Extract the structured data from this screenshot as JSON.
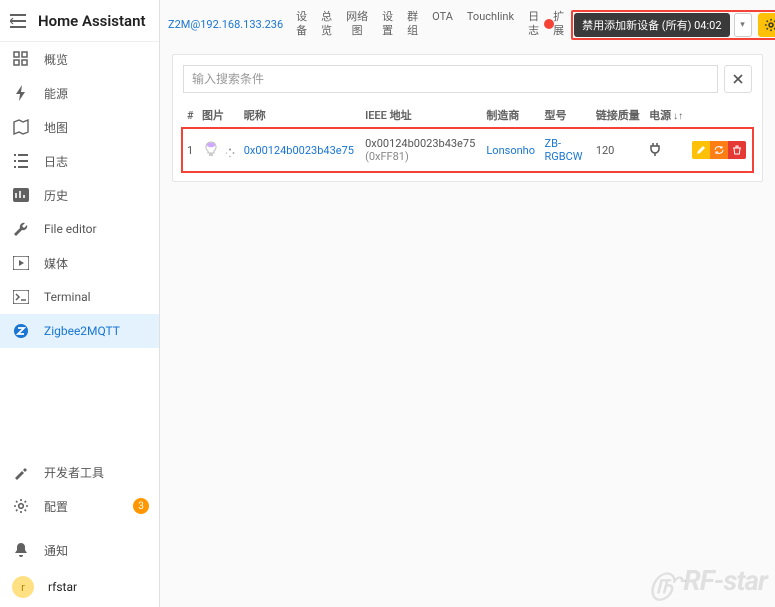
{
  "app": {
    "title": "Home Assistant"
  },
  "sidebar": {
    "items": [
      {
        "id": "overview",
        "label": "概览"
      },
      {
        "id": "energy",
        "label": "能源"
      },
      {
        "id": "map",
        "label": "地图"
      },
      {
        "id": "logbook",
        "label": "日志"
      },
      {
        "id": "history",
        "label": "历史"
      },
      {
        "id": "fileeditor",
        "label": "File editor"
      },
      {
        "id": "media",
        "label": "媒体"
      },
      {
        "id": "terminal",
        "label": "Terminal"
      },
      {
        "id": "z2m",
        "label": "Zigbee2MQTT"
      }
    ],
    "bottom": [
      {
        "id": "devtools",
        "label": "开发者工具"
      },
      {
        "id": "settings",
        "label": "配置",
        "badge": "3"
      },
      {
        "id": "notify",
        "label": "通知"
      }
    ],
    "user": {
      "initial": "r",
      "name": "rfstar"
    }
  },
  "header": {
    "host": "Z2M@192.168.133.236",
    "tabs": [
      {
        "l1": "设",
        "l2": "备"
      },
      {
        "l1": "总",
        "l2": "览"
      },
      {
        "l1": "网络",
        "l2": "图"
      },
      {
        "l1": "设",
        "l2": "置"
      },
      {
        "l1": "群",
        "l2": "组"
      },
      {
        "l1": "OTA",
        "l2": ""
      },
      {
        "l1": "Touchlink",
        "l2": ""
      },
      {
        "l1": "日",
        "l2": "志"
      },
      {
        "l1": "扩",
        "l2": "展"
      }
    ],
    "disable_label": "禁用添加新设备 (所有) 04:02"
  },
  "card": {
    "search_placeholder": "输入搜索条件",
    "columns": {
      "idx": "#",
      "pic": "图片",
      "nick": "昵称",
      "ieee": "IEEE 地址",
      "mfr": "制造商",
      "model": "型号",
      "lqi": "链接质量",
      "power": "电源"
    },
    "rows": [
      {
        "idx": "1",
        "nick": "0x00124b0023b43e75",
        "ieee_long": "0x00124b0023b43e75",
        "ieee_short": "(0xFF81)",
        "mfr": "Lonsonho",
        "model": "ZB-RGBCW",
        "lqi": "120"
      }
    ]
  },
  "watermark": "RF-star"
}
